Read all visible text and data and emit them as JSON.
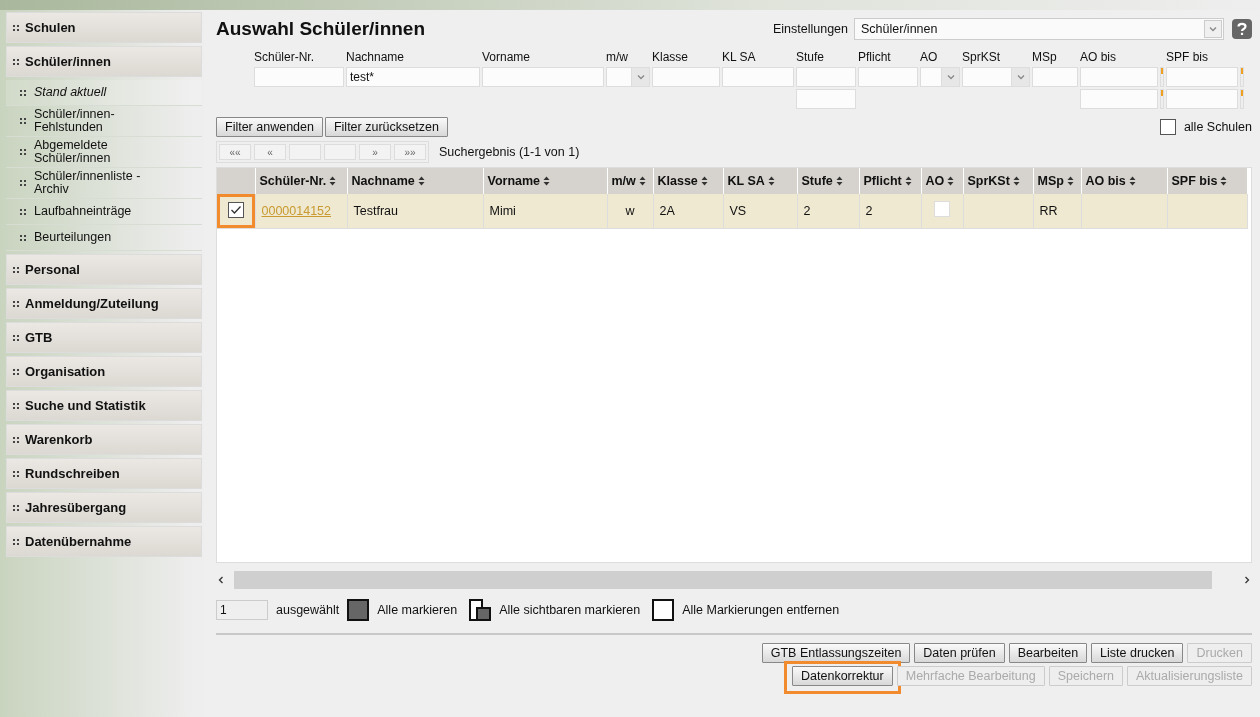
{
  "sidebar": [
    {
      "label": "Schulen"
    },
    {
      "label": "Schüler/innen",
      "children": [
        {
          "label": "Stand aktuell",
          "selected": true
        },
        {
          "label": "Schüler/innen-Fehlstunden",
          "selected": false
        },
        {
          "label": "Abgemeldete Schüler/innen",
          "selected": false
        },
        {
          "label": "Schüler/innenliste - Archiv",
          "selected": false
        },
        {
          "label": "Laufbahneinträge",
          "selected": false
        },
        {
          "label": "Beurteilungen",
          "selected": false
        }
      ]
    },
    {
      "label": "Personal"
    },
    {
      "label": "Anmeldung/Zuteilung"
    },
    {
      "label": "GTB"
    },
    {
      "label": "Organisation"
    },
    {
      "label": "Suche und Statistik"
    },
    {
      "label": "Warenkorb"
    },
    {
      "label": "Rundschreiben"
    },
    {
      "label": "Jahresübergang"
    },
    {
      "label": "Datenübernahme"
    }
  ],
  "header": {
    "title": "Auswahl Schüler/innen",
    "settings_label": "Einstellungen",
    "settings_value": "Schüler/innen"
  },
  "filters": [
    {
      "label": "Schüler-Nr.",
      "kind": "text"
    },
    {
      "label": "Nachname",
      "kind": "text",
      "value": "test*"
    },
    {
      "label": "Vorname",
      "kind": "text"
    },
    {
      "label": "m/w",
      "kind": "select"
    },
    {
      "label": "Klasse",
      "kind": "text"
    },
    {
      "label": "KL SA",
      "kind": "text"
    },
    {
      "label": "Stufe",
      "kind": "range"
    },
    {
      "label": "Pflicht",
      "kind": "text"
    },
    {
      "label": "AO",
      "kind": "select"
    },
    {
      "label": "SprKSt",
      "kind": "select"
    },
    {
      "label": "MSp",
      "kind": "text"
    },
    {
      "label": "AO bis",
      "kind": "daterange"
    },
    {
      "label": "SPF bis",
      "kind": "daterange"
    }
  ],
  "filter_buttons": [
    "Filter anwenden",
    "Filter zurücksetzen"
  ],
  "all_schools": {
    "label": "alle Schulen",
    "checked": false
  },
  "pager": [
    {
      "kind": "glyph",
      "label": "««"
    },
    {
      "kind": "glyph",
      "label": "«"
    },
    {
      "kind": "blank"
    },
    {
      "kind": "blank"
    },
    {
      "kind": "glyph",
      "label": "»"
    },
    {
      "kind": "glyph",
      "label": "»»"
    }
  ],
  "result_text": "Suchergebnis (1-1 von 1)",
  "table": {
    "columns": [
      "Schüler-Nr.",
      "Nachname",
      "Vorname",
      "m/w",
      "Klasse",
      "KL SA",
      "Stufe",
      "Pflicht",
      "AO",
      "SprKSt",
      "MSp",
      "AO bis",
      "SPF bis"
    ],
    "rows": [
      {
        "selected": true,
        "checked": true,
        "highlighted": true,
        "cells": [
          {
            "kind": "link",
            "text": "0000014152"
          },
          {
            "kind": "text",
            "text": "Testfrau"
          },
          {
            "kind": "text",
            "text": "Mimi"
          },
          {
            "kind": "center",
            "text": "w"
          },
          {
            "kind": "text",
            "text": "2A"
          },
          {
            "kind": "text",
            "text": "VS"
          },
          {
            "kind": "text",
            "text": "2"
          },
          {
            "kind": "text",
            "text": "2"
          },
          {
            "kind": "checkbox",
            "checked": false
          },
          {
            "kind": "empty"
          },
          {
            "kind": "text",
            "text": "RR"
          },
          {
            "kind": "empty"
          },
          {
            "kind": "empty"
          }
        ]
      }
    ]
  },
  "selection": {
    "count": "1",
    "label": "ausgewählt",
    "actions": [
      {
        "kind": "all",
        "label": "Alle markieren"
      },
      {
        "kind": "visible",
        "label": "Alle sichtbaren markieren"
      },
      {
        "kind": "none",
        "label": "Alle Markierungen entfernen"
      }
    ]
  },
  "action_rows": [
    [
      {
        "label": "GTB Entlassungszeiten",
        "disabled": false,
        "highlighted": false
      },
      {
        "label": "Daten prüfen",
        "disabled": false,
        "highlighted": false
      },
      {
        "label": "Bearbeiten",
        "disabled": false,
        "highlighted": false
      },
      {
        "label": "Liste drucken",
        "disabled": false,
        "highlighted": false
      },
      {
        "label": "Drucken",
        "disabled": true,
        "highlighted": false
      }
    ],
    [
      {
        "label": "Datenkorrektur",
        "disabled": false,
        "highlighted": true
      },
      {
        "label": "Mehrfache Bearbeitung",
        "disabled": true,
        "highlighted": false
      },
      {
        "label": "Speichern",
        "disabled": true,
        "highlighted": false
      },
      {
        "label": "Aktualisierungsliste",
        "disabled": true,
        "highlighted": false
      }
    ]
  ]
}
